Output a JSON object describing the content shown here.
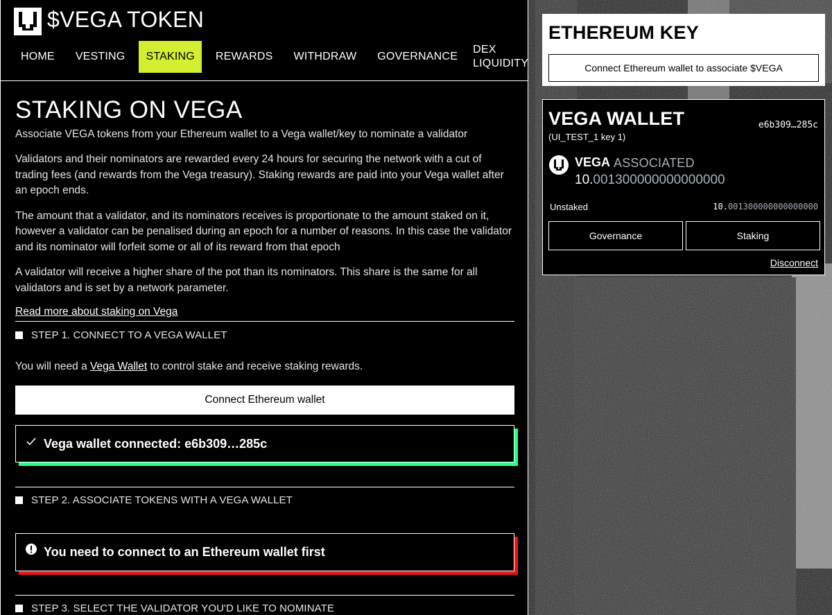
{
  "app": {
    "title": "$VEGA TOKEN"
  },
  "nav": {
    "items": [
      {
        "label": "HOME",
        "active": false
      },
      {
        "label": "VESTING",
        "active": false
      },
      {
        "label": "STAKING",
        "active": true
      },
      {
        "label": "REWARDS",
        "active": false
      },
      {
        "label": "WITHDRAW",
        "active": false
      },
      {
        "label": "GOVERNANCE",
        "active": false
      },
      {
        "label": "DEX LIQUIDITY",
        "active": false
      }
    ]
  },
  "page": {
    "title": "STAKING ON VEGA",
    "intro": "Associate VEGA tokens from your Ethereum wallet to a Vega wallet/key to nominate a validator",
    "paragraphs": [
      "Validators and their nominators are rewarded every 24 hours for securing the network with a cut of trading fees (and rewards from the Vega treasury). Staking rewards are paid into your Vega wallet after an epoch ends.",
      "The amount that a validator, and its nominators receives is proportionate to the amount staked on it, however a validator can be penalised during an epoch for a number of reasons. In this case the validator and its nominator will forfeit some or all of its reward from that epoch",
      "A validator will receive a higher share of the pot than its nominators. This share is the same for all validators and is set by a network parameter."
    ],
    "read_more": "Read more about staking on Vega"
  },
  "steps": {
    "step1": {
      "title": "STEP 1. CONNECT TO A VEGA WALLET",
      "desc_prefix": "You will need a ",
      "desc_link": "Vega Wallet",
      "desc_suffix": " to control stake and receive staking rewards.",
      "button": "Connect Ethereum wallet",
      "callout": "Vega wallet connected: e6b309…285c"
    },
    "step2": {
      "title": "STEP 2. ASSOCIATE TOKENS WITH A VEGA WALLET",
      "callout": "You need to connect to an Ethereum wallet first"
    },
    "step3": {
      "title": "STEP 3. SELECT THE VALIDATOR YOU'D LIKE TO NOMINATE"
    }
  },
  "ethereum_key": {
    "title": "ETHEREUM KEY",
    "button": "Connect Ethereum wallet to associate $VEGA"
  },
  "vega_wallet": {
    "title": "VEGA WALLET",
    "key_short": "e6b309…285c",
    "key_name": "(UI_TEST_1 key 1)",
    "token": "VEGA",
    "status": "ASSOCIATED",
    "balance_int": "10.",
    "balance_dec": "001300000000000000",
    "unstaked_label": "Unstaked",
    "unstaked_int": "10.",
    "unstaked_dec": "001300000000000000",
    "governance_button": "Governance",
    "staking_button": "Staking",
    "disconnect": "Disconnect"
  },
  "colors": {
    "accent": "#d4ee31",
    "success": "#26ff8a",
    "danger": "#ed1515",
    "muted": "#a7b1b9"
  },
  "icons": [
    "vega-logo-icon",
    "checkmark-icon",
    "alert-icon",
    "vega-token-icon"
  ]
}
